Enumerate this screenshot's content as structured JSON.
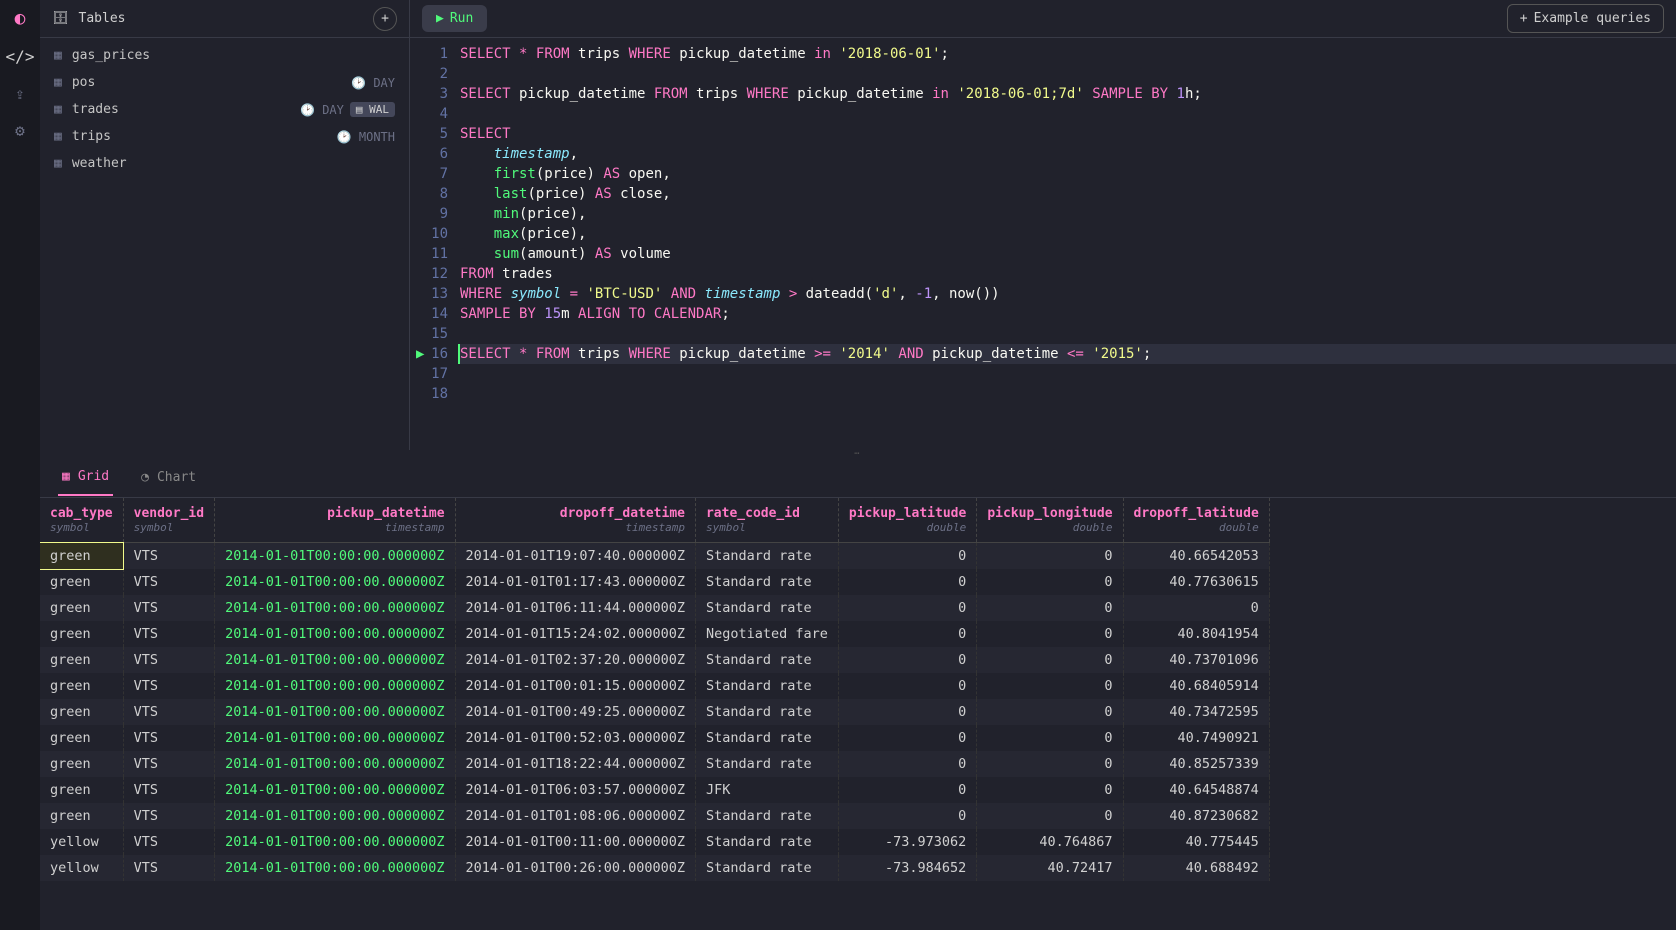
{
  "sidebar": {
    "nav_items": [
      "code",
      "upload",
      "settings"
    ]
  },
  "tables_panel": {
    "title": "Tables",
    "items": [
      {
        "name": "gas_prices",
        "meta": ""
      },
      {
        "name": "pos",
        "meta": "DAY"
      },
      {
        "name": "trades",
        "meta": "DAY",
        "badge": "WAL"
      },
      {
        "name": "trips",
        "meta": "MONTH"
      },
      {
        "name": "weather",
        "meta": ""
      }
    ]
  },
  "toolbar": {
    "run_label": "Run",
    "example_label": "Example queries"
  },
  "editor": {
    "active_line": 16,
    "lines": [
      [
        [
          "kw",
          "SELECT"
        ],
        [
          "plain",
          " "
        ],
        [
          "op",
          "*"
        ],
        [
          "plain",
          " "
        ],
        [
          "kw",
          "FROM"
        ],
        [
          "plain",
          " trips "
        ],
        [
          "kw",
          "WHERE"
        ],
        [
          "plain",
          " pickup_datetime "
        ],
        [
          "kw",
          "in"
        ],
        [
          "plain",
          " "
        ],
        [
          "str",
          "'2018-06-01'"
        ],
        [
          "plain",
          ";"
        ]
      ],
      [],
      [
        [
          "kw",
          "SELECT"
        ],
        [
          "plain",
          " pickup_datetime "
        ],
        [
          "kw",
          "FROM"
        ],
        [
          "plain",
          " trips "
        ],
        [
          "kw",
          "WHERE"
        ],
        [
          "plain",
          " pickup_datetime "
        ],
        [
          "kw",
          "in"
        ],
        [
          "plain",
          " "
        ],
        [
          "str",
          "'2018-06-01;7d'"
        ],
        [
          "plain",
          " "
        ],
        [
          "kw",
          "SAMPLE BY"
        ],
        [
          "plain",
          " "
        ],
        [
          "num",
          "1"
        ],
        [
          "plain",
          "h;"
        ]
      ],
      [],
      [
        [
          "kw",
          "SELECT"
        ]
      ],
      [
        [
          "plain",
          "    "
        ],
        [
          "ident",
          "timestamp"
        ],
        [
          "plain",
          ","
        ]
      ],
      [
        [
          "plain",
          "    "
        ],
        [
          "func",
          "first"
        ],
        [
          "plain",
          "(price) "
        ],
        [
          "kw",
          "AS"
        ],
        [
          "plain",
          " open,"
        ]
      ],
      [
        [
          "plain",
          "    "
        ],
        [
          "func",
          "last"
        ],
        [
          "plain",
          "(price) "
        ],
        [
          "kw",
          "AS"
        ],
        [
          "plain",
          " close,"
        ]
      ],
      [
        [
          "plain",
          "    "
        ],
        [
          "func",
          "min"
        ],
        [
          "plain",
          "(price),"
        ]
      ],
      [
        [
          "plain",
          "    "
        ],
        [
          "func",
          "max"
        ],
        [
          "plain",
          "(price),"
        ]
      ],
      [
        [
          "plain",
          "    "
        ],
        [
          "func",
          "sum"
        ],
        [
          "plain",
          "(amount) "
        ],
        [
          "kw",
          "AS"
        ],
        [
          "plain",
          " volume"
        ]
      ],
      [
        [
          "kw",
          "FROM"
        ],
        [
          "plain",
          " trades"
        ]
      ],
      [
        [
          "kw",
          "WHERE"
        ],
        [
          "plain",
          " "
        ],
        [
          "ident",
          "symbol"
        ],
        [
          "plain",
          " "
        ],
        [
          "op",
          "="
        ],
        [
          "plain",
          " "
        ],
        [
          "str",
          "'BTC-USD'"
        ],
        [
          "plain",
          " "
        ],
        [
          "kw",
          "AND"
        ],
        [
          "plain",
          " "
        ],
        [
          "ident",
          "timestamp"
        ],
        [
          "plain",
          " "
        ],
        [
          "op",
          ">"
        ],
        [
          "plain",
          " dateadd("
        ],
        [
          "str",
          "'d'"
        ],
        [
          "plain",
          ", "
        ],
        [
          "num",
          "-1"
        ],
        [
          "plain",
          ", now())"
        ]
      ],
      [
        [
          "kw",
          "SAMPLE BY"
        ],
        [
          "plain",
          " "
        ],
        [
          "num",
          "15"
        ],
        [
          "plain",
          "m "
        ],
        [
          "kw",
          "ALIGN TO CALENDAR"
        ],
        [
          "plain",
          ";"
        ]
      ],
      [],
      [
        [
          "kw",
          "SELECT"
        ],
        [
          "plain",
          " "
        ],
        [
          "op",
          "*"
        ],
        [
          "plain",
          " "
        ],
        [
          "kw",
          "FROM"
        ],
        [
          "plain",
          " trips "
        ],
        [
          "kw",
          "WHERE"
        ],
        [
          "plain",
          " pickup_datetime "
        ],
        [
          "op",
          ">="
        ],
        [
          "plain",
          " "
        ],
        [
          "str",
          "'2014'"
        ],
        [
          "plain",
          " "
        ],
        [
          "kw",
          "AND"
        ],
        [
          "plain",
          " pickup_datetime "
        ],
        [
          "op",
          "<="
        ],
        [
          "plain",
          " "
        ],
        [
          "str",
          "'2015'"
        ],
        [
          "plain",
          ";"
        ]
      ],
      [],
      []
    ]
  },
  "results": {
    "tabs": {
      "grid": "Grid",
      "chart": "Chart"
    },
    "columns": [
      {
        "name": "cab_type",
        "type": "symbol",
        "align": "left"
      },
      {
        "name": "vendor_id",
        "type": "symbol",
        "align": "left"
      },
      {
        "name": "pickup_datetime",
        "type": "timestamp",
        "align": "right",
        "ts": true
      },
      {
        "name": "dropoff_datetime",
        "type": "timestamp",
        "align": "right"
      },
      {
        "name": "rate_code_id",
        "type": "symbol",
        "align": "left"
      },
      {
        "name": "pickup_latitude",
        "type": "double",
        "align": "right"
      },
      {
        "name": "pickup_longitude",
        "type": "double",
        "align": "right"
      },
      {
        "name": "dropoff_latitude",
        "type": "double",
        "align": "right"
      }
    ],
    "rows": [
      [
        "green",
        "VTS",
        "2014-01-01T00:00:00.000000Z",
        "2014-01-01T19:07:40.000000Z",
        "Standard rate",
        "0",
        "0",
        "40.66542053"
      ],
      [
        "green",
        "VTS",
        "2014-01-01T00:00:00.000000Z",
        "2014-01-01T01:17:43.000000Z",
        "Standard rate",
        "0",
        "0",
        "40.77630615"
      ],
      [
        "green",
        "VTS",
        "2014-01-01T00:00:00.000000Z",
        "2014-01-01T06:11:44.000000Z",
        "Standard rate",
        "0",
        "0",
        "0"
      ],
      [
        "green",
        "VTS",
        "2014-01-01T00:00:00.000000Z",
        "2014-01-01T15:24:02.000000Z",
        "Negotiated fare",
        "0",
        "0",
        "40.8041954"
      ],
      [
        "green",
        "VTS",
        "2014-01-01T00:00:00.000000Z",
        "2014-01-01T02:37:20.000000Z",
        "Standard rate",
        "0",
        "0",
        "40.73701096"
      ],
      [
        "green",
        "VTS",
        "2014-01-01T00:00:00.000000Z",
        "2014-01-01T00:01:15.000000Z",
        "Standard rate",
        "0",
        "0",
        "40.68405914"
      ],
      [
        "green",
        "VTS",
        "2014-01-01T00:00:00.000000Z",
        "2014-01-01T00:49:25.000000Z",
        "Standard rate",
        "0",
        "0",
        "40.73472595"
      ],
      [
        "green",
        "VTS",
        "2014-01-01T00:00:00.000000Z",
        "2014-01-01T00:52:03.000000Z",
        "Standard rate",
        "0",
        "0",
        "40.7490921"
      ],
      [
        "green",
        "VTS",
        "2014-01-01T00:00:00.000000Z",
        "2014-01-01T18:22:44.000000Z",
        "Standard rate",
        "0",
        "0",
        "40.85257339"
      ],
      [
        "green",
        "VTS",
        "2014-01-01T00:00:00.000000Z",
        "2014-01-01T06:03:57.000000Z",
        "JFK",
        "0",
        "0",
        "40.64548874"
      ],
      [
        "green",
        "VTS",
        "2014-01-01T00:00:00.000000Z",
        "2014-01-01T01:08:06.000000Z",
        "Standard rate",
        "0",
        "0",
        "40.87230682"
      ],
      [
        "yellow",
        "VTS",
        "2014-01-01T00:00:00.000000Z",
        "2014-01-01T00:11:00.000000Z",
        "Standard rate",
        "-73.973062",
        "40.764867",
        "40.775445"
      ],
      [
        "yellow",
        "VTS",
        "2014-01-01T00:00:00.000000Z",
        "2014-01-01T00:26:00.000000Z",
        "Standard rate",
        "-73.984652",
        "40.72417",
        "40.688492"
      ]
    ]
  }
}
